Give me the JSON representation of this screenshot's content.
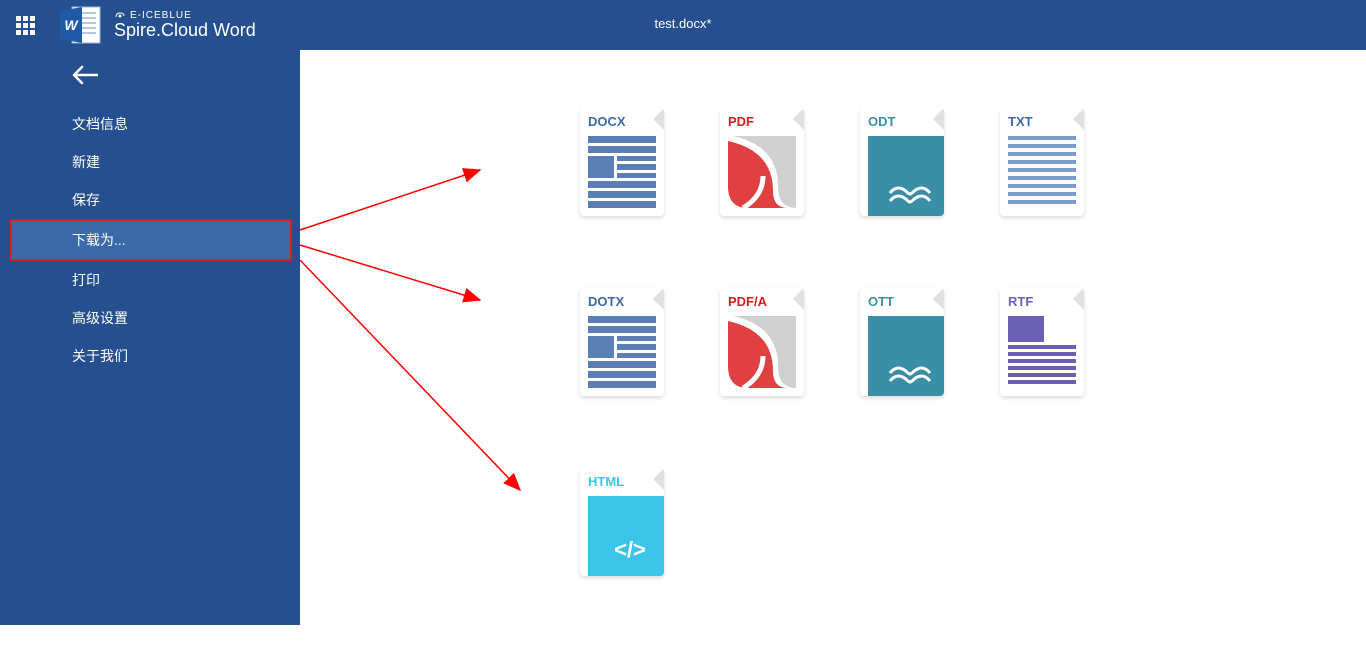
{
  "header": {
    "brand": "E-ICEBLUE",
    "title": "Spire.Cloud Word",
    "document_name": "test.docx*"
  },
  "sidebar": {
    "items": [
      {
        "label": "文档信息"
      },
      {
        "label": "新建"
      },
      {
        "label": "保存"
      },
      {
        "label": "下载为...",
        "active": true
      },
      {
        "label": "打印"
      },
      {
        "label": "高级设置"
      },
      {
        "label": "关于我们"
      }
    ]
  },
  "formats": {
    "row1": [
      {
        "name": "DOCX",
        "cls": "label-docx",
        "type": "docx"
      },
      {
        "name": "PDF",
        "cls": "label-pdf",
        "type": "pdf"
      },
      {
        "name": "ODT",
        "cls": "label-odt",
        "type": "odt"
      },
      {
        "name": "TXT",
        "cls": "label-txt",
        "type": "txt"
      }
    ],
    "row2": [
      {
        "name": "DOTX",
        "cls": "label-dotx",
        "type": "docx"
      },
      {
        "name": "PDF/A",
        "cls": "label-pdfa",
        "type": "pdf"
      },
      {
        "name": "OTT",
        "cls": "label-ott",
        "type": "odt"
      },
      {
        "name": "RTF",
        "cls": "label-rtf",
        "type": "rtf"
      }
    ],
    "row3": [
      {
        "name": "HTML",
        "cls": "label-html",
        "type": "html"
      }
    ]
  }
}
